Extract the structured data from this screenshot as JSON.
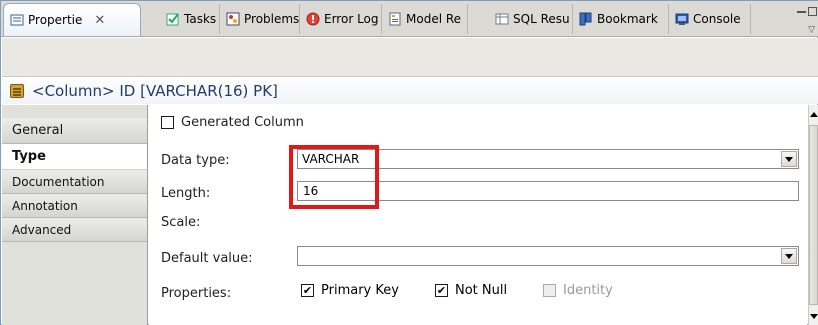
{
  "tabs": [
    {
      "label": "Propertie",
      "icon": "properties-icon",
      "active": true,
      "close": "✕"
    },
    {
      "label": "Tasks",
      "icon": "tasks-icon"
    },
    {
      "label": "Problems",
      "icon": "problems-icon"
    },
    {
      "label": "Error Log",
      "icon": "error-log-icon"
    },
    {
      "label": "Model Re",
      "icon": "model-report-icon"
    },
    {
      "label": "SQL Resu",
      "icon": "sql-results-icon"
    },
    {
      "label": "Bookmark",
      "icon": "bookmark-icon"
    },
    {
      "label": "Console",
      "icon": "console-icon"
    }
  ],
  "header": {
    "title": "<Column> ID [VARCHAR(16) PK]",
    "icon": "column-icon"
  },
  "sidebar": {
    "items": [
      {
        "label": "General"
      },
      {
        "label": "Type",
        "selected": true
      },
      {
        "label": "Documentation"
      },
      {
        "label": "Annotation"
      },
      {
        "label": "Advanced"
      }
    ]
  },
  "form": {
    "generated_column": {
      "label": "Generated Column",
      "checked": false
    },
    "data_type": {
      "label": "Data type:",
      "value": "VARCHAR"
    },
    "length": {
      "label": "Length:",
      "value": "16"
    },
    "scale": {
      "label": "Scale:"
    },
    "default_value": {
      "label": "Default value:",
      "value": ""
    },
    "properties": {
      "label": "Properties:",
      "primary_key": {
        "label": "Primary Key",
        "checked": true
      },
      "not_null": {
        "label": "Not Null",
        "checked": true
      },
      "identity": {
        "label": "Identity",
        "checked": false,
        "disabled": true
      }
    }
  },
  "colors": {
    "highlight": "#e01818",
    "header_text": "#233b6b",
    "sidebar_bg": "#e1e1dc",
    "tabbar_bg": "#dcdad5"
  },
  "glyphs": {
    "check": "✔"
  }
}
